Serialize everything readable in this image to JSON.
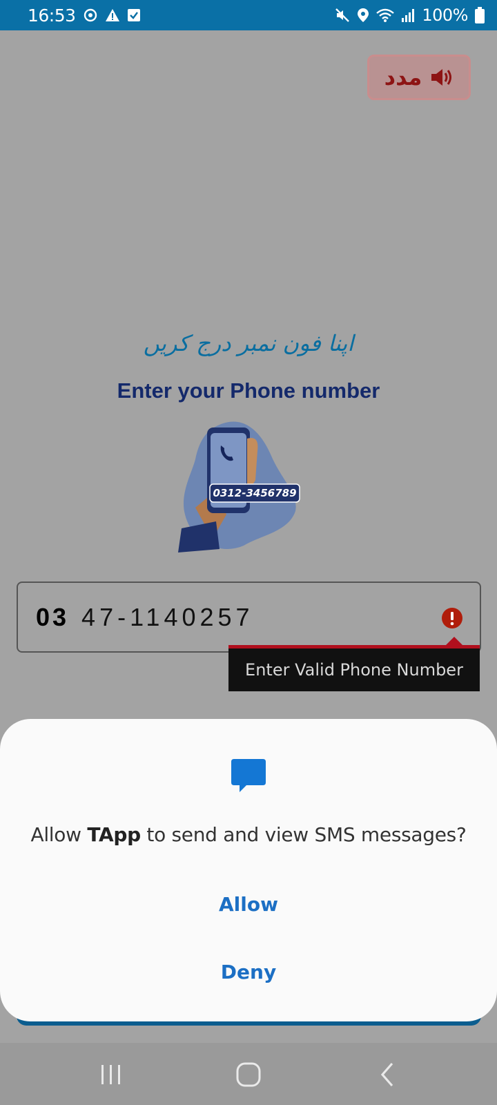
{
  "status_bar": {
    "time": "16:53",
    "battery_percent": "100%",
    "color": "#0a70a6"
  },
  "help_button": {
    "label": "مدد",
    "icon": "speaker-icon"
  },
  "titles": {
    "urdu": "اپنا فون نمبر درج کریں",
    "english": "Enter your Phone number"
  },
  "illustration": {
    "phone_sample": "0312-3456789"
  },
  "phone_input": {
    "prefix": "03",
    "value": "47-1140257",
    "error_icon": "error-icon"
  },
  "error_tooltip": {
    "text": "Enter Valid Phone Number"
  },
  "dialog": {
    "message_before": "Allow ",
    "app_name": "TApp",
    "message_after": " to send and view SMS messages?",
    "allow_label": "Allow",
    "deny_label": "Deny",
    "icon": "sms-icon",
    "accent": "#1c6fc4"
  },
  "nav": {
    "icons": [
      "recents-icon",
      "home-icon",
      "back-icon"
    ]
  }
}
